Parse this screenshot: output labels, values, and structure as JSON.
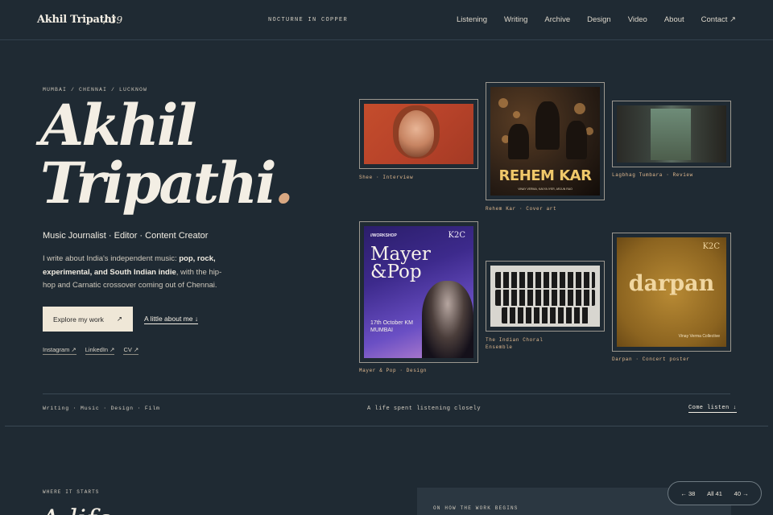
{
  "header": {
    "brand": "Akhil Tripathi",
    "brand_number": "/ 39",
    "tagline": "NOCTURNE IN COPPER",
    "nav": [
      "Listening",
      "Writing",
      "Archive",
      "Design",
      "Video",
      "About",
      "Contact ↗"
    ]
  },
  "hero": {
    "locations": "MUMBAI / CHENNAI / LUCKNOW",
    "name_line1": "Akhil",
    "name_line2": "Tripathi",
    "name_dot": ".",
    "roles": "Music Journalist · Editor · Content Creator",
    "bio_intro": "I write about India's independent music: ",
    "bio_bold": "pop, rock, experimental, and South Indian indie",
    "bio_end": ", with the hip-hop and Carnatic crossover coming out of Chennai.",
    "cta_label": "Explore my work",
    "cta_arrow": "↗",
    "about_link": "A little about me ↓",
    "socials": [
      "Instagram ↗",
      "LinkedIn ↗",
      "CV ↗"
    ]
  },
  "gallery": {
    "shee_caption": "Shee · Interview",
    "rehem_caption": "Rehem Kar · Cover art",
    "rehem_title": "REHEM KAR",
    "rehem_credits": "VINAY VERMA, KAVYA IYER, ARJUN RAO",
    "lagbhag_caption": "Lagbhag Tumbara · Review",
    "mayer_caption": "Mayer & Pop · Design",
    "mayer_tag": "//WORKSHOP",
    "mayer_logo": "K2C",
    "mayer_title": "Mayer &Pop",
    "mayer_date": "17th October KM MUMBAI",
    "choral_caption": "The Indian Choral Ensemble",
    "darpan_caption": "Darpan · Concert poster",
    "darpan_title": "darpan",
    "darpan_logo": "K2C",
    "darpan_footer": "Vinay Verma Collective"
  },
  "strip": {
    "categories": "Writing · Music · Design · Film",
    "motto": "A life spent listening closely",
    "come_listen": "Come listen ↓"
  },
  "lower": {
    "where": "WHERE IT STARTS",
    "heading": "A life",
    "panel_label": "ON HOW THE WORK BEGINS"
  },
  "pager": {
    "prev": "← 38",
    "all": "All 41",
    "next": "40 →"
  }
}
